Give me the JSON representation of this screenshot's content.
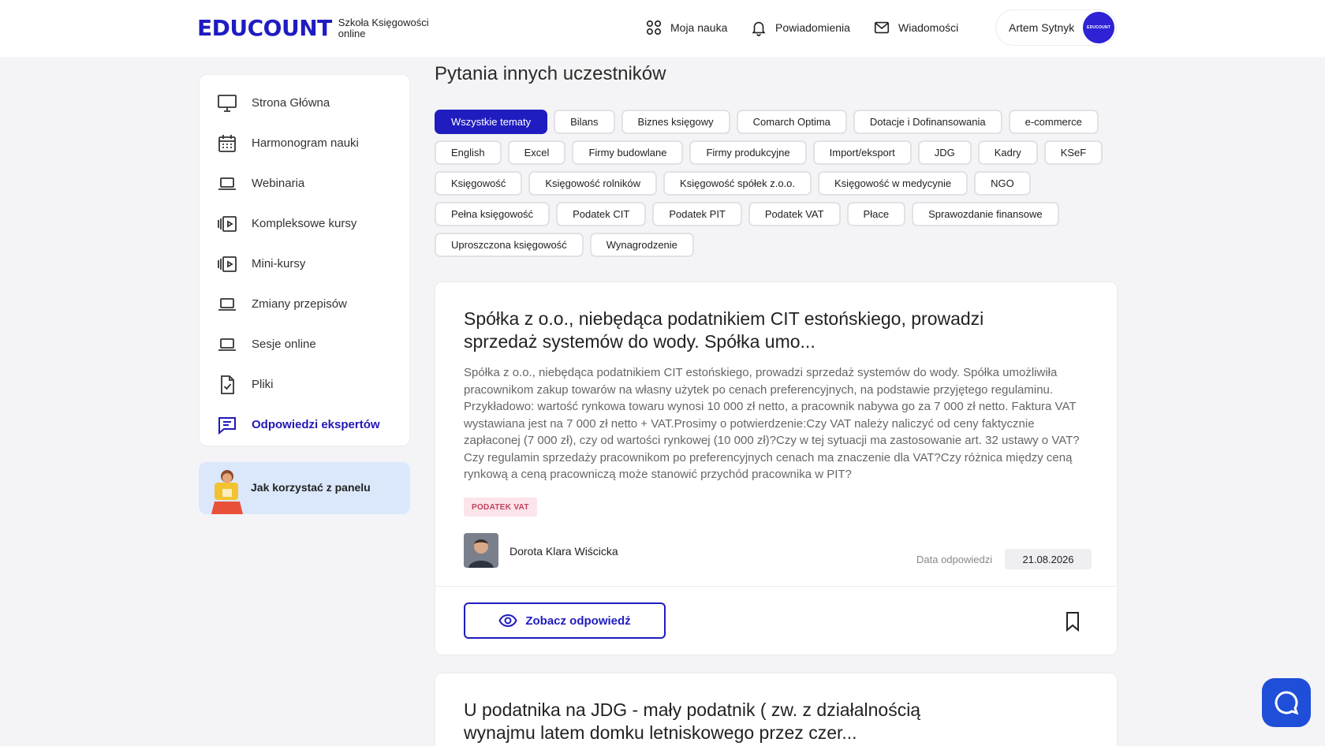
{
  "header": {
    "logo_word": "EDUCOUNT",
    "logo_tagline": "Szkoła Księgowości online",
    "nav": [
      {
        "label": "Moja nauka",
        "icon": "grid-icon"
      },
      {
        "label": "Powiadomienia",
        "icon": "bell-icon"
      },
      {
        "label": "Wiadomości",
        "icon": "mail-icon"
      }
    ],
    "user_name": "Artem Sytnyk",
    "avatar_text": "EDUCOUNT"
  },
  "sidebar": {
    "items": [
      {
        "label": "Strona Główna",
        "icon": "monitor-icon",
        "active": false
      },
      {
        "label": "Harmonogram nauki",
        "icon": "calendar-icon",
        "active": false
      },
      {
        "label": "Webinaria",
        "icon": "laptop-icon",
        "active": false
      },
      {
        "label": "Kompleksowe kursy",
        "icon": "video-library-icon",
        "active": false
      },
      {
        "label": "Mini-kursy",
        "icon": "video-library-icon",
        "active": false
      },
      {
        "label": "Zmiany przepisów",
        "icon": "laptop-icon",
        "active": false
      },
      {
        "label": "Sesje online",
        "icon": "laptop-icon",
        "active": false
      },
      {
        "label": "Pliki",
        "icon": "file-check-icon",
        "active": false
      },
      {
        "label": "Odpowiedzi ekspertów",
        "icon": "chat-lines-icon",
        "active": true
      }
    ],
    "help_label": "Jak korzystać z panelu"
  },
  "main": {
    "title": "Pytania innych uczestników",
    "topics": [
      "Wszystkie tematy",
      "Bilans",
      "Biznes księgowy",
      "Comarch Optima",
      "Dotacje i Dofinansowania",
      "e-commerce",
      "English",
      "Excel",
      "Firmy budowlane",
      "Firmy produkcyjne",
      "Import/eksport",
      "JDG",
      "Kadry",
      "KSeF",
      "Księgowość",
      "Księgowość rolników",
      "Księgowość spółek z.o.o.",
      "Księgowość w medycynie",
      "NGO",
      "Pełna księgowość",
      "Podatek CIT",
      "Podatek PIT",
      "Podatek VAT",
      "Płace",
      "Sprawozdanie finansowe",
      "Uproszczona księgowość",
      "Wynagrodzenie"
    ],
    "active_topic": "Wszystkie tematy",
    "questions": [
      {
        "title": "Spółka z o.o., niebędąca podatnikiem CIT estońskiego, prowadzi sprzedaż systemów do wody. Spółka umo...",
        "body": "Spółka z o.o., niebędąca podatnikiem CIT estońskiego, prowadzi sprzedaż systemów do wody. Spółka umożliwiła pracownikom zakup towarów na własny użytek po cenach preferencyjnych, na podstawie przyjętego regulaminu. Przykładowo: wartość rynkowa towaru wynosi 10 000 zł netto, a pracownik nabywa go za 7 000 zł netto. Faktura VAT wystawiana jest na 7 000 zł netto + VAT.Prosimy o potwierdzenie:Czy VAT należy naliczyć od ceny faktycznie zapłaconej (7 000 zł), czy od wartości rynkowej (10 000 zł)?Czy w tej sytuacji ma zastosowanie art. 32 ustawy o VAT? Czy regulamin sprzedaży pracownikom po preferencyjnych cenach ma znaczenie dla VAT?Czy różnica między ceną rynkową a ceną pracowniczą może stanowić przychód pracownika w PIT?",
        "tag": "PODATEK VAT",
        "expert": "Dorota Klara Wiścicka",
        "date_label": "Data odpowiedzi",
        "date": "21.08.2026",
        "button_label": "Zobacz odpowiedź"
      },
      {
        "title": "U podatnika na JDG - mały podatnik ( zw. z działalnością wynajmu latem domku letniskowego przez czer..."
      }
    ]
  },
  "colors": {
    "brand": "#1f1cc0",
    "tag_bg": "#fbe4ea",
    "tag_text": "#c2405e",
    "help_bg": "#dbe7fb",
    "chat_button": "#1f4fd8"
  }
}
